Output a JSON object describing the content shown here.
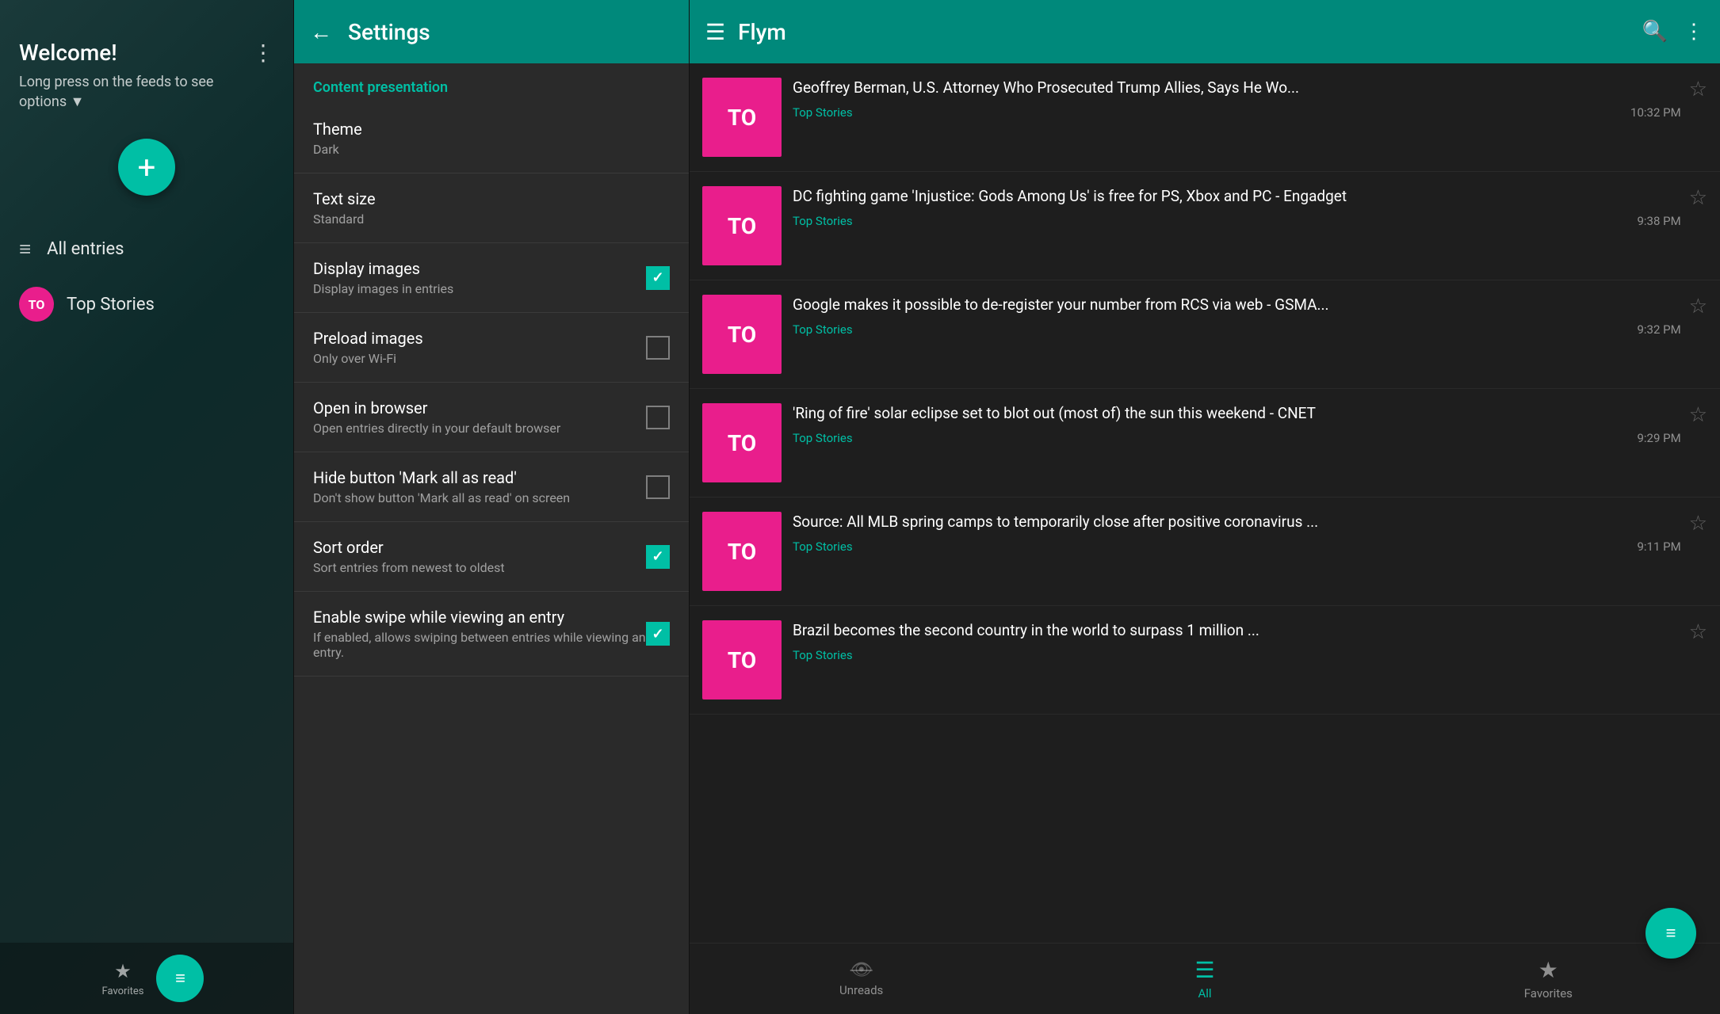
{
  "left": {
    "welcome_title": "Welcome!",
    "welcome_subtitle": "Long press on the feeds to see options ▼",
    "fab_icon": "+",
    "nav_all_entries": "All entries",
    "nav_all_icon": "≡",
    "feed_name": "Top Stories",
    "feed_initials": "TO",
    "bottom_fab_icon": "≡",
    "favorites_label": "Favorites"
  },
  "settings": {
    "header_title": "Settings",
    "back_icon": "←",
    "section_label": "Content presentation",
    "items": [
      {
        "title": "Theme",
        "subtitle": "Dark",
        "type": "value",
        "checked": null
      },
      {
        "title": "Text size",
        "subtitle": "Standard",
        "type": "value",
        "checked": null
      },
      {
        "title": "Display images",
        "subtitle": "Display images in entries",
        "type": "checkbox",
        "checked": true
      },
      {
        "title": "Preload images",
        "subtitle": "Only over Wi-Fi",
        "type": "checkbox",
        "checked": false
      },
      {
        "title": "Open in browser",
        "subtitle": "Open entries directly in your default browser",
        "type": "checkbox",
        "checked": false
      },
      {
        "title": "Hide button 'Mark all as read'",
        "subtitle": "Don't show button 'Mark all as read' on screen",
        "type": "checkbox",
        "checked": false
      },
      {
        "title": "Sort order",
        "subtitle": "Sort entries from newest to oldest",
        "type": "checkbox",
        "checked": true
      },
      {
        "title": "Enable swipe while viewing an entry",
        "subtitle": "If enabled, allows swiping between entries while viewing an entry.",
        "type": "checkbox",
        "checked": true
      }
    ]
  },
  "flym": {
    "header_title": "Flym",
    "menu_icon": "☰",
    "search_icon": "🔍",
    "more_icon": "⋮",
    "news_items": [
      {
        "thumb": "TO",
        "title": "Geoffrey Berman, U.S. Attorney Who Prosecuted Trump Allies, Says He Wo...",
        "source": "Top Stories",
        "time": "10:32 PM"
      },
      {
        "thumb": "TO",
        "title": "DC fighting game 'Injustice: Gods Among Us' is free for PS, Xbox and PC - Engadget",
        "source": "Top Stories",
        "time": "9:38 PM"
      },
      {
        "thumb": "TO",
        "title": "Google makes it possible to de-register your number from RCS via web - GSMA...",
        "source": "Top Stories",
        "time": "9:32 PM"
      },
      {
        "thumb": "TO",
        "title": "'Ring of fire' solar eclipse set to blot out (most of) the sun this weekend - CNET",
        "source": "Top Stories",
        "time": "9:29 PM"
      },
      {
        "thumb": "TO",
        "title": "Source: All MLB spring camps to temporarily close after positive coronavirus ...",
        "source": "Top Stories",
        "time": "9:11 PM"
      },
      {
        "thumb": "TO",
        "title": "Brazil becomes the second country in the world to surpass 1 million ...",
        "source": "Top Stories",
        "time": ""
      }
    ],
    "bottom_tabs": [
      {
        "icon": "👁",
        "label": "Unreads",
        "active": false
      },
      {
        "icon": "☰",
        "label": "All",
        "active": true
      },
      {
        "icon": "★",
        "label": "Favorites",
        "active": false
      }
    ],
    "fab_icon": "≡"
  }
}
